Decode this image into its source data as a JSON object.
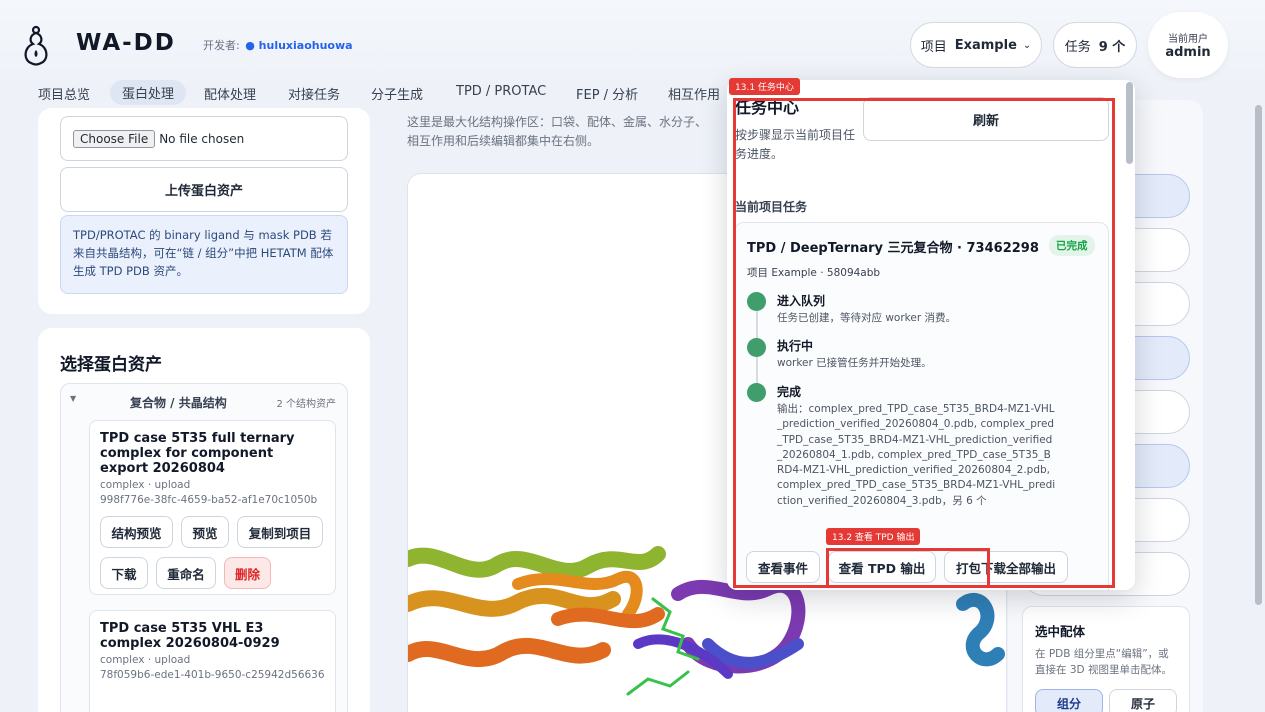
{
  "header": {
    "brand": "WA-DD",
    "developer_label": "开发者:",
    "developer_name": "huluxiaohuowa",
    "project_label": "项目",
    "project_value": "Example",
    "tasks_label": "任务",
    "tasks_value": "9 个",
    "user_label": "当前用户",
    "user_name": "admin"
  },
  "tabs": [
    "项目总览",
    "蛋白处理",
    "配体处理",
    "对接任务",
    "分子生成",
    "TPD / PROTAC",
    "FEP / 分析",
    "相互作用"
  ],
  "left": {
    "choose_file": "Choose File",
    "no_file": "No file chosen",
    "upload_button": "上传蛋白资产",
    "info_text": "TPD/PROTAC 的 binary ligand 与 mask PDB 若来自共晶结构，可在“链 / 组分”中把 HETATM 配体生成 TPD PDB 资产。",
    "section_title": "选择蛋白资产",
    "group_title": "复合物 / 共晶结构",
    "group_count": "2 个结构资产",
    "assets": [
      {
        "title": "TPD case 5T35 full ternary complex for component export 20260804",
        "meta": "complex · upload",
        "id": "998f776e-38fc-4659-ba52-af1e70c1050b",
        "buttons": [
          "结构预览",
          "预览",
          "复制到项目",
          "下载",
          "重命名",
          "删除"
        ]
      },
      {
        "title": "TPD case 5T35 VHL E3 complex 20260804-0929",
        "meta": "complex · upload",
        "id": "78f059b6-ede1-401b-9650-c25942d56636"
      }
    ]
  },
  "middle": {
    "intro": "这里是最大化结构操作区：口袋、配体、金属、水分子、相互作用和后续编辑都集中在右侧。"
  },
  "right": {
    "ligand_title": "选中配体",
    "ligand_desc": "在 PDB 组分里点“编辑”，或直接在 3D 视图里单击配体。",
    "btn_group": "组分",
    "btn_atom": "原子"
  },
  "task_center": {
    "title": "任务中心",
    "subtitle": "按步骤显示当前项目任务进度。",
    "refresh": "刷新",
    "section": "当前项目任务",
    "task": {
      "title": "TPD / DeepTernary 三元复合物 · 73462298",
      "status": "已完成",
      "meta": "项目 Example · 58094abb",
      "steps": [
        {
          "label": "进入队列",
          "desc": "任务已创建，等待对应 worker 消费。"
        },
        {
          "label": "执行中",
          "desc": "worker 已接管任务并开始处理。"
        },
        {
          "label": "完成",
          "desc": "输出：complex_pred_TPD_case_5T35_BRD4-MZ1-VHL_prediction_verified_20260804_0.pdb, complex_pred_TPD_case_5T35_BRD4-MZ1-VHL_prediction_verified_20260804_1.pdb, complex_pred_TPD_case_5T35_BRD4-MZ1-VHL_prediction_verified_20260804_2.pdb, complex_pred_TPD_case_5T35_BRD4-MZ1-VHL_prediction_verified_20260804_3.pdb，另 6 个"
        }
      ],
      "buttons": [
        "查看事件",
        "查看 TPD 输出",
        "打包下载全部输出"
      ]
    }
  },
  "annotations": [
    {
      "label": "13.1 任务中心"
    },
    {
      "label": "13.2 查看 TPD 输出"
    }
  ],
  "colors": {
    "annotation": "#e53935",
    "success": "#3f9e6b",
    "accent": "#2563eb"
  }
}
